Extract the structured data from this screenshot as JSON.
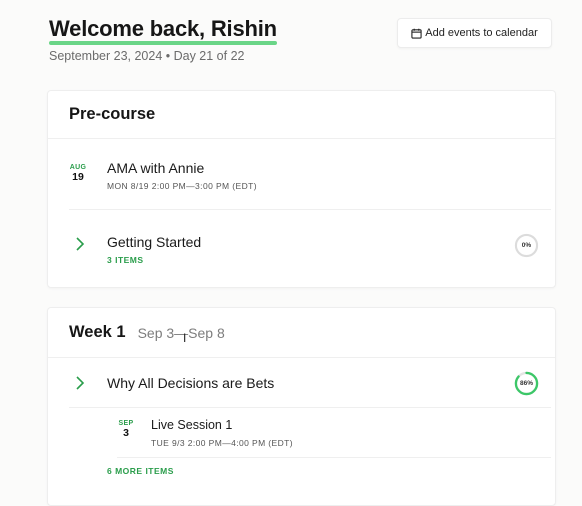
{
  "header": {
    "title": "Welcome back, Rishin",
    "subtitle": "September 23, 2024 • Day 21 of 22",
    "calendar_button": "Add events to calendar",
    "calendar_icon": "calendar-icon"
  },
  "colors": {
    "accent": "#2a9d4b",
    "underline": "#5ad07a",
    "ring_progress": "#3cc768"
  },
  "sections": [
    {
      "heading": "Pre-course",
      "event": {
        "month": "AUG",
        "day": "19",
        "title": "AMA with Annie",
        "time": "MON 8/19  2:00 PM—3:00 PM (EDT)"
      },
      "module": {
        "title": "Getting Started",
        "meta": "3 ITEMS",
        "progress_label": "0%",
        "progress": 0
      }
    },
    {
      "heading": "Week 1",
      "range": "Sep 3—Sep 8",
      "module": {
        "title": "Why All Decisions are Bets",
        "progress_label": "86%",
        "progress": 0.86
      },
      "event": {
        "month": "SEP",
        "day": "3",
        "title": "Live Session 1",
        "time": "TUE 9/3  2:00 PM—4:00 PM (EDT)"
      },
      "more": "6 MORE ITEMS"
    }
  ]
}
